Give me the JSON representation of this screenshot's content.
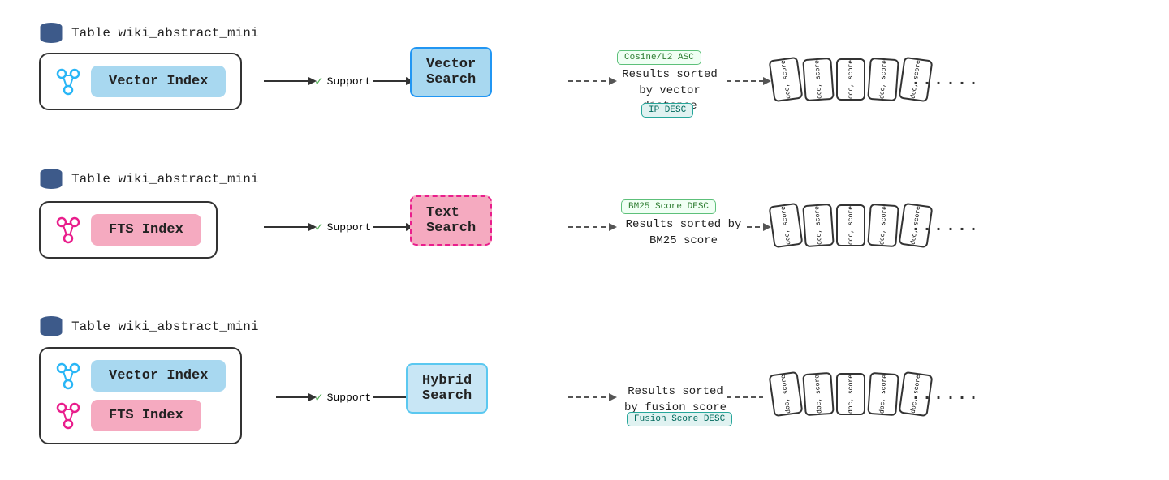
{
  "rows": [
    {
      "id": "row1",
      "tableLabel": "Table wiki_abstract_mini",
      "indexType": "vector",
      "indexLabel": "Vector Index",
      "searchLabel": "Vector Search",
      "resultDesc": "Results sorted by vector\n        distance",
      "badge1": "Cosine/L2 ASC",
      "badge2": "IP DESC",
      "arrowLabel": "Support"
    },
    {
      "id": "row2",
      "tableLabel": "Table wiki_abstract_mini",
      "indexType": "fts",
      "indexLabel": "FTS Index",
      "searchLabel": "Text Search",
      "resultDesc": "Results sorted by BM25 score",
      "badge1": "BM25 Score DESC",
      "badge2": null,
      "arrowLabel": "Support"
    },
    {
      "id": "row3",
      "tableLabel": "Table wiki_abstract_mini",
      "indexType": "hybrid",
      "indexLabels": [
        "Vector Index",
        "FTS Index"
      ],
      "searchLabel": "Hybrid Search",
      "resultDesc": "Results sorted by fusion score",
      "badge1": "Fusion Score DESC",
      "badge2": null,
      "arrowLabel": "Support"
    }
  ],
  "dots": "...",
  "docCardLabel": "doc, score",
  "checkmark": "✓"
}
